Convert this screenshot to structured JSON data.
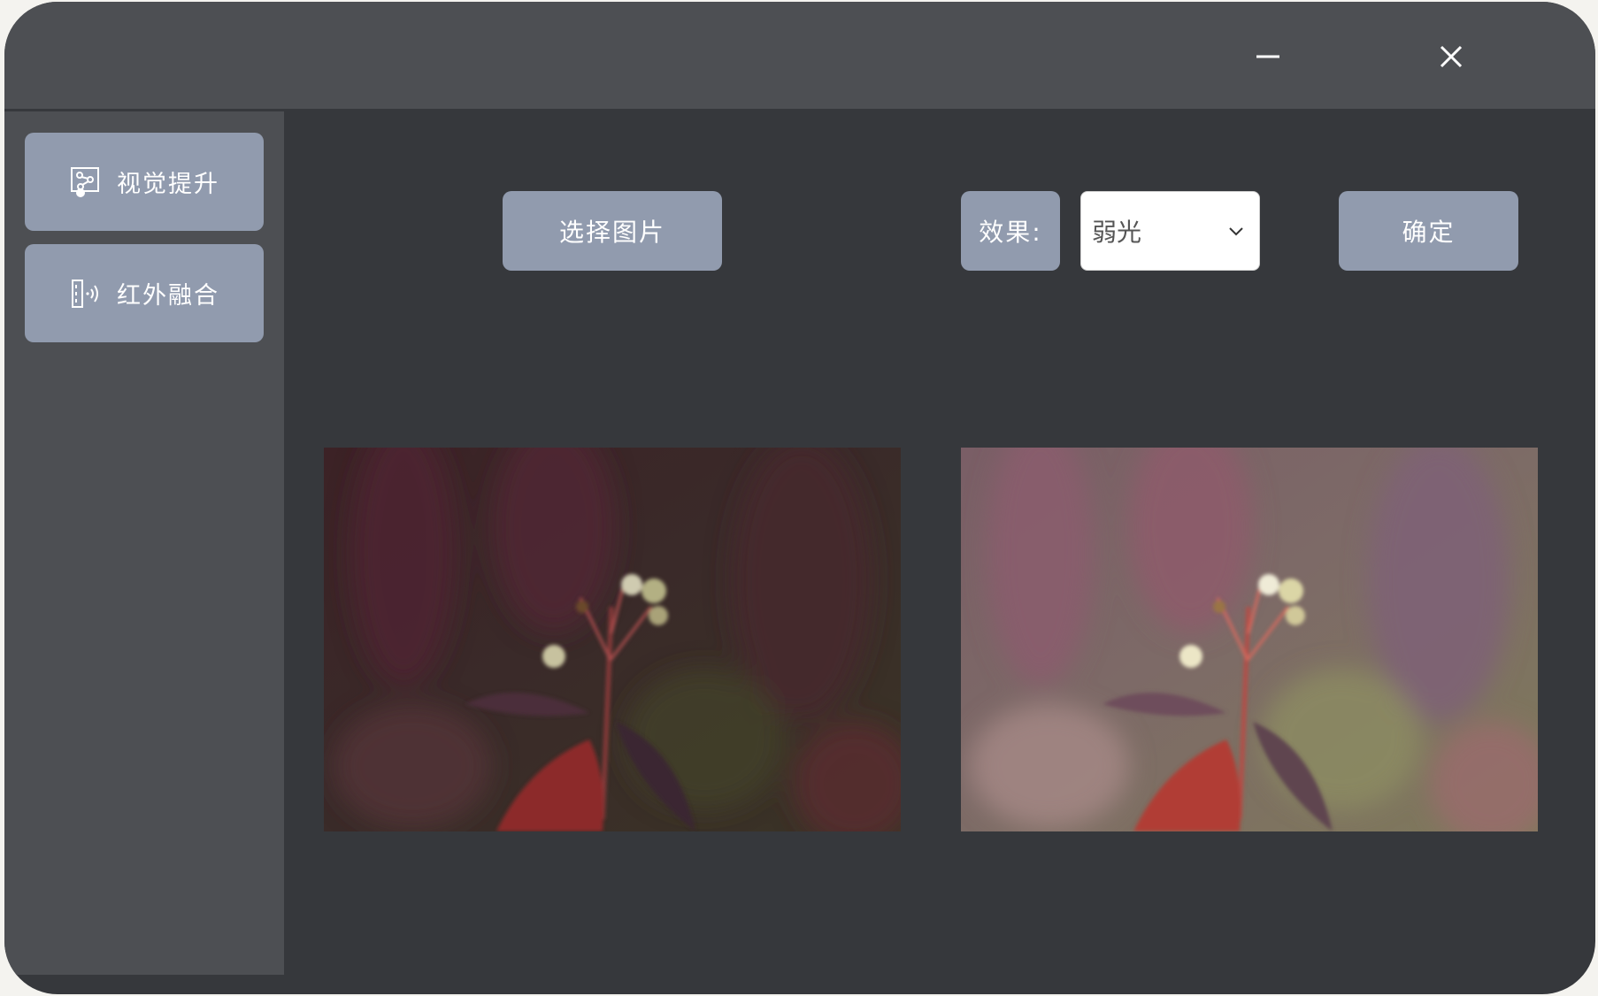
{
  "window": {
    "minimize_icon": "minimize-icon",
    "close_icon": "close-icon"
  },
  "sidebar": {
    "items": [
      {
        "label": "视觉提升",
        "icon": "image-enhance-icon",
        "selected": true
      },
      {
        "label": "红外融合",
        "icon": "infrared-signal-icon",
        "selected": false
      }
    ]
  },
  "toolbar": {
    "select_image_label": "选择图片",
    "effect_label": "效果:",
    "effect_value": "弱光",
    "confirm_label": "确定"
  },
  "images": {
    "original": "photo-original-lowlight",
    "result": "photo-enhanced-result"
  },
  "colors": {
    "window_bg": "#36383c",
    "titlebar_bg": "#4d4f53",
    "sidebar_bg": "#4d4f53",
    "button_bg": "#919bae",
    "button_text": "#ffffff"
  }
}
